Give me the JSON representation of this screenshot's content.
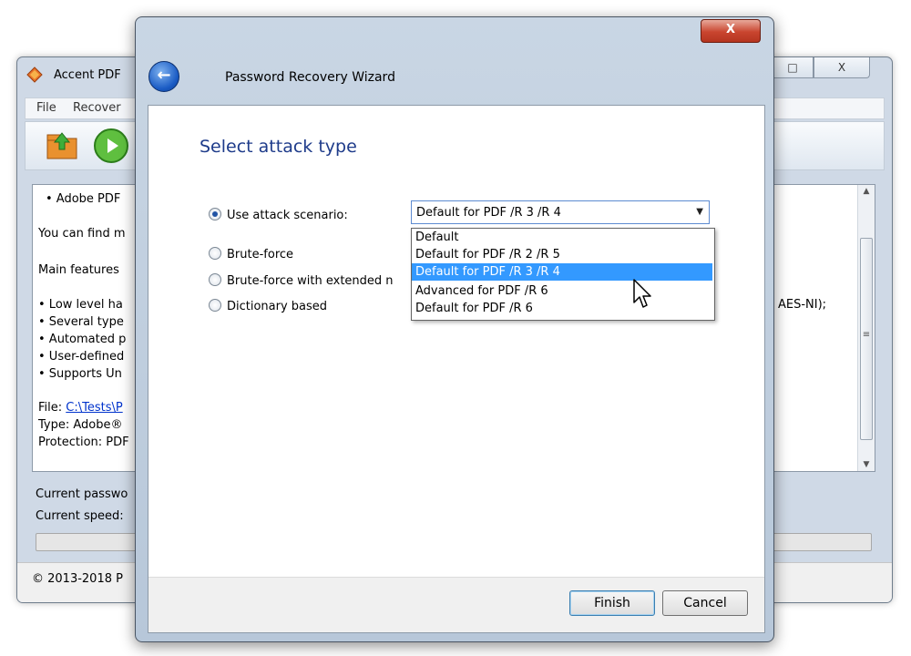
{
  "main_window": {
    "title": "Accent PDF",
    "menu": [
      "File",
      "Recover"
    ],
    "content_lines": [
      "• Adobe PDF",
      "You can find m",
      "Main features",
      "• Low level ha",
      "• Several type",
      "• Automated p",
      "• User-defined",
      "• Supports Un"
    ],
    "aes_fragment": "AES-NI);",
    "file_label": "File: ",
    "file_path": "C:\\Tests\\P",
    "type_line": "Type: Adobe®",
    "protection_line": "Protection: PDF",
    "current_password": "Current passwo",
    "current_speed": "Current speed:",
    "copyright": "© 2013-2018 P",
    "controls": {
      "restore": "□",
      "close": "X"
    }
  },
  "wizard": {
    "title": "Password Recovery Wizard",
    "close_label": "X",
    "back_label": "←",
    "heading": "Select attack type",
    "options": [
      {
        "label": "Use attack scenario:",
        "checked": true
      },
      {
        "label": "Brute-force",
        "checked": false
      },
      {
        "label": "Brute-force with extended n",
        "checked": false
      },
      {
        "label": "Dictionary based",
        "checked": false
      }
    ],
    "combo_value": "Default for PDF /R 3 /R 4",
    "dropdown_options": [
      "Default",
      "Default for PDF /R 2 /R 5",
      "Default for PDF /R 3 /R 4",
      "Advanced for PDF /R 6",
      "Default for PDF /R 6"
    ],
    "selected_option_index": 2,
    "finish_label": "Finish",
    "cancel_label": "Cancel"
  },
  "colors": {
    "heading": "#1e3b8a",
    "selection": "#3399ff",
    "close_button": "#c9452f"
  },
  "icons": [
    "app-icon",
    "open-folder-icon",
    "start-icon",
    "back-arrow-icon",
    "mouse-cursor-icon",
    "combo-arrow-icon"
  ]
}
